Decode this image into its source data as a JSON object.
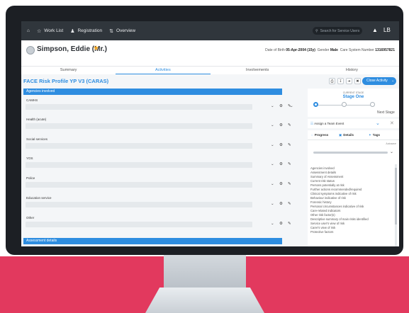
{
  "nav": {
    "items": [
      {
        "label": "Work List",
        "icon": "star-icon"
      },
      {
        "label": "Registration",
        "icon": "person-icon"
      },
      {
        "label": "Overview",
        "icon": "overview-icon"
      }
    ],
    "search_placeholder": "Search for Service Users",
    "user_initials": "LB"
  },
  "person": {
    "name": "Simpson, Eddie (Mr.)",
    "dob_label": "Date of Birth",
    "dob": "05-Apr-2004 (15y)",
    "gender_label": "Gender",
    "gender": "Male",
    "csn_label": "Care System Number",
    "csn": "1316957821"
  },
  "tabs": [
    {
      "label": "Summary",
      "active": false
    },
    {
      "label": "Activities",
      "active": true
    },
    {
      "label": "Involvements",
      "active": false
    },
    {
      "label": "History",
      "active": false
    }
  ],
  "form": {
    "title": "FACE Risk Profile YP V3 (CARAS)",
    "section1": "Agencies involved",
    "fields": [
      "CAMHS",
      "Health (acute)",
      "Social services",
      "YOS",
      "Police",
      "Education service",
      "Other"
    ],
    "section2": "Assessment details"
  },
  "toolbar": {
    "close_label": "Close Activity"
  },
  "stage": {
    "caption": "CURRENT STAGE",
    "name": "Stage One",
    "next_label": "Next Stage"
  },
  "assign": {
    "label": "Assign a Team Event"
  },
  "panel_tabs": [
    {
      "label": "Progress",
      "icon": "progress-icon"
    },
    {
      "label": "Details",
      "icon": "details-icon"
    },
    {
      "label": "Tags",
      "icon": "tag-icon"
    }
  ],
  "progress": {
    "autosave": "Autosave",
    "outline": [
      "Agencies involved",
      "Assessment details",
      "Summary of Assessment",
      "Current risk status",
      "Persons potentially at risk",
      "Further actions recommended/required",
      "Clinical symptoms indicative of risk",
      "Behaviour indicative of risk",
      "Forensic history",
      "Personal circumstances indicative of risk",
      "Care-related indicators",
      "Other risk factor(s)",
      "Descriptive summary of main risks identified",
      "Service user's view of risk",
      "Carer's view of risk",
      "Protective factors"
    ]
  },
  "colors": {
    "accent": "#2e8de0",
    "star": "#f4a41c",
    "nav": "#30363c",
    "backdrop": "#e2395e"
  }
}
